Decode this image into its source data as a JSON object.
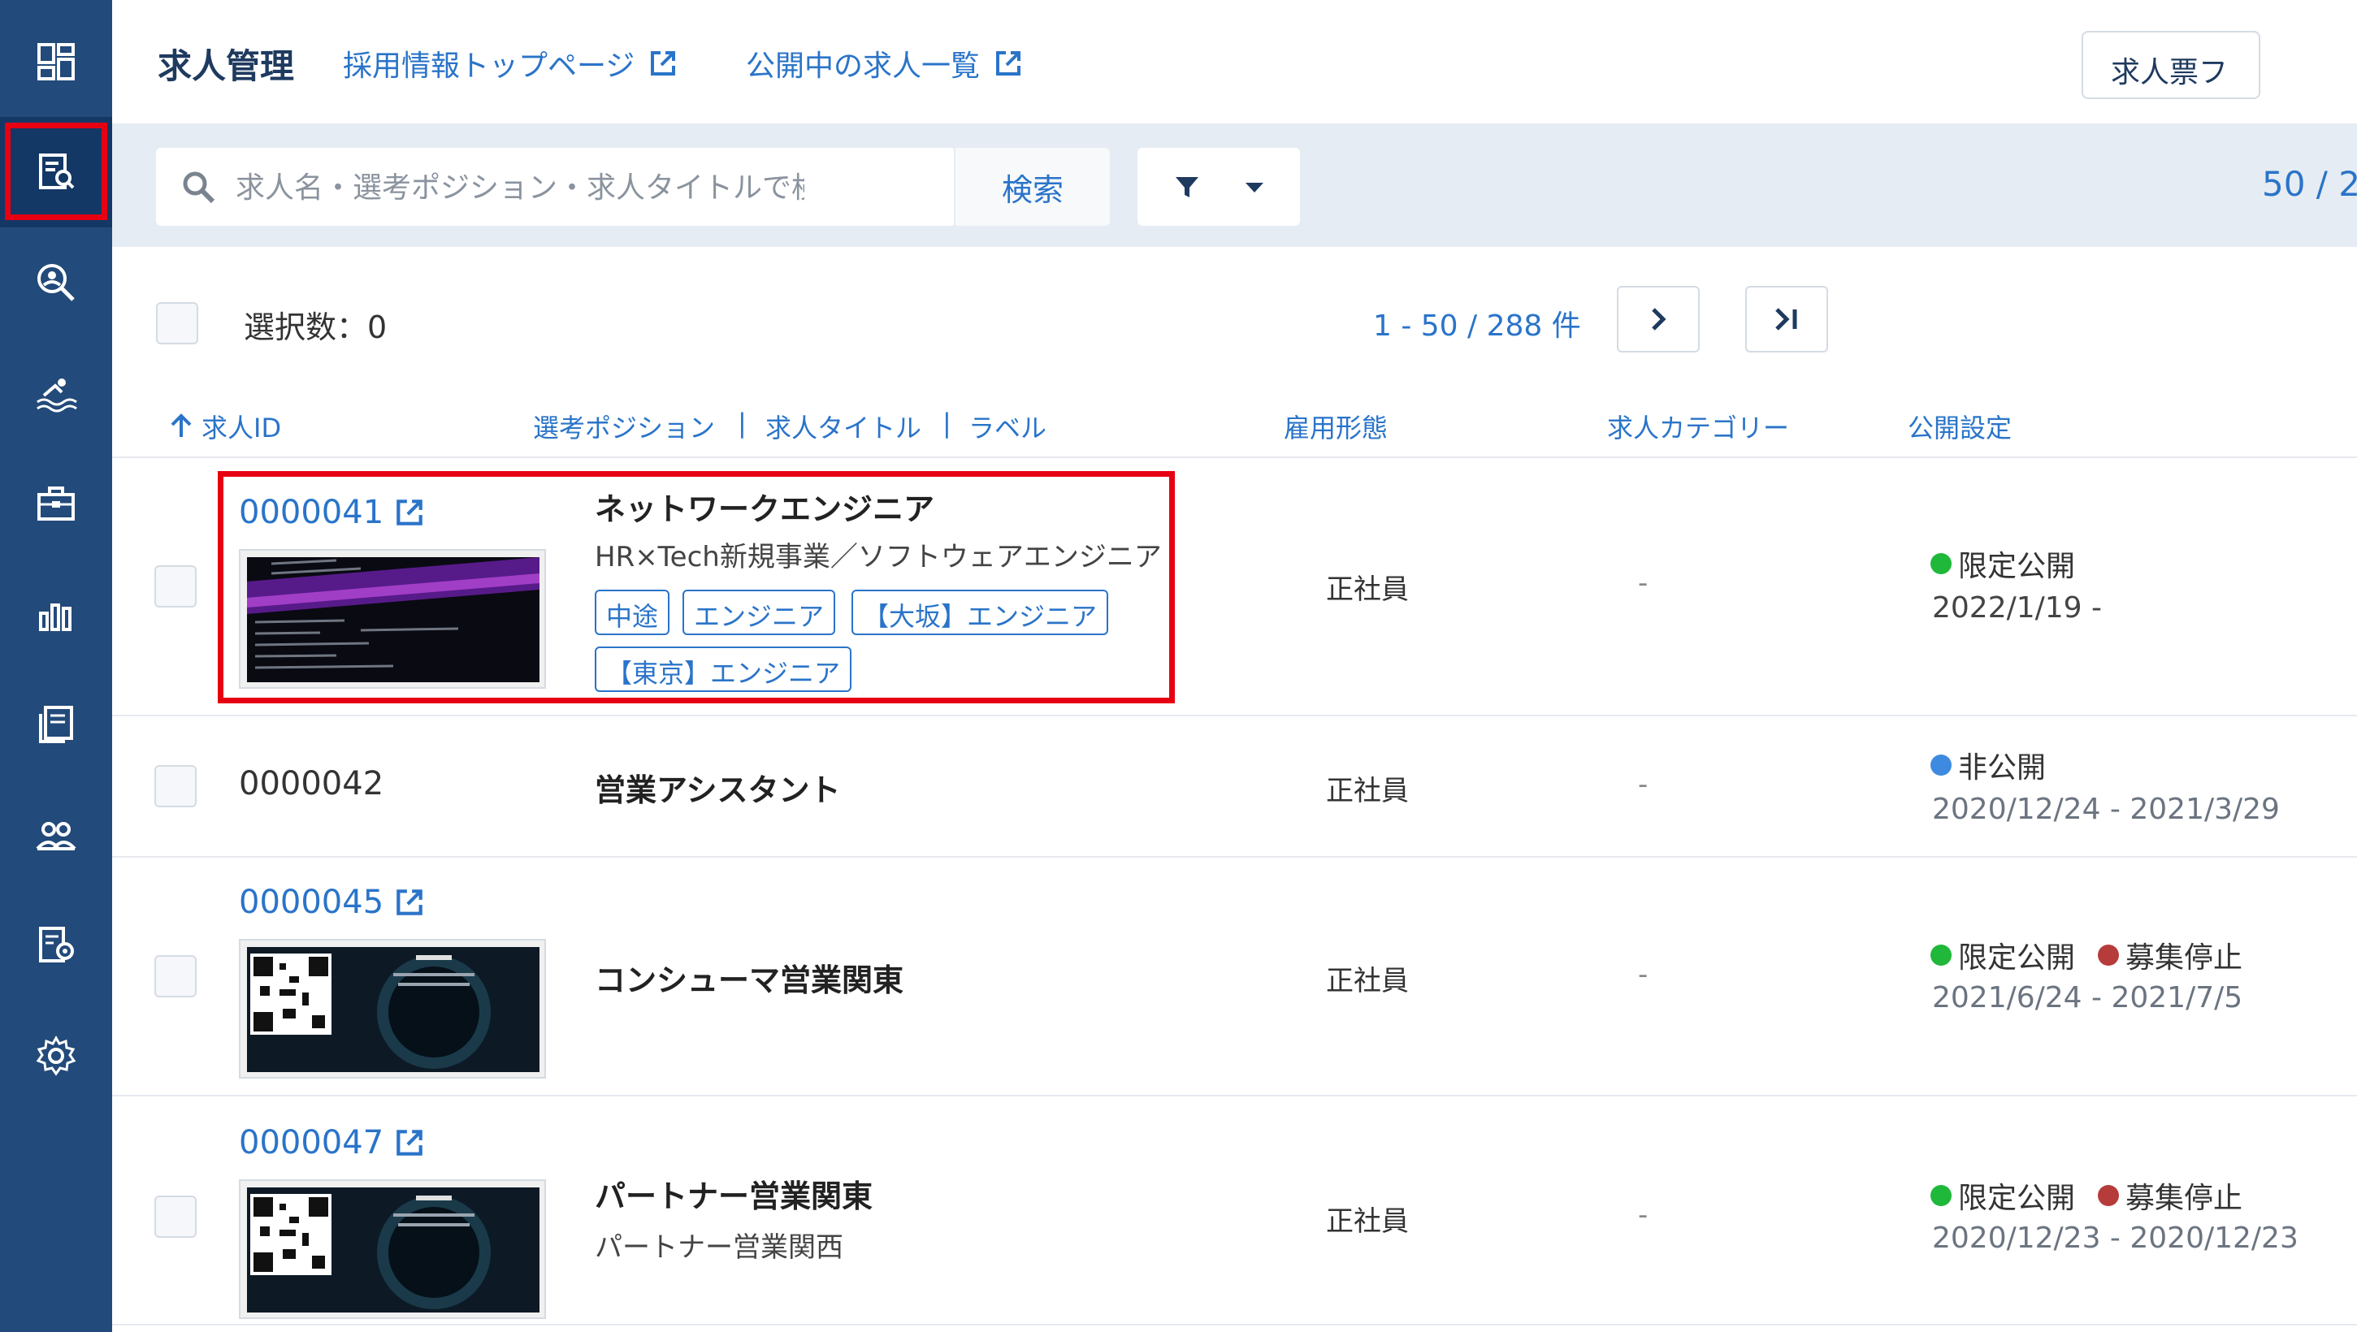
{
  "header": {
    "title": "求人管理",
    "link_recruit_top": "採用情報トップページ",
    "link_open_jobs": "公開中の求人一覧",
    "right_button": "求人票フ"
  },
  "search": {
    "placeholder": "求人名・選考ポジション・求人タイトルで検索",
    "button": "検索",
    "count": "50 / 2"
  },
  "selection": {
    "label": "選択数：0"
  },
  "pagination": {
    "range": "1 - 50 / 288 件"
  },
  "columns": {
    "id": "求人ID",
    "position": "選考ポジション",
    "title": "求人タイトル",
    "label": "ラベル",
    "employment": "雇用形態",
    "category": "求人カテゴリー",
    "publish": "公開設定"
  },
  "rows": [
    {
      "id": "0000041",
      "position": "ネットワークエンジニア",
      "subtitle": "HR×Tech新規事業／ソフトウェアエンジニア",
      "tags": [
        "中途",
        "エンジニア",
        "【大坂】エンジニア",
        "【東京】エンジニア"
      ],
      "employment": "正社員",
      "category": "-",
      "status1": "限定公開",
      "period": "2022/1/19 -"
    },
    {
      "id": "0000042",
      "position": "営業アシスタント",
      "employment": "正社員",
      "category": "-",
      "status1": "非公開",
      "period": "2020/12/24 - 2021/3/29"
    },
    {
      "id": "0000045",
      "position": "コンシューマ営業関東",
      "employment": "正社員",
      "category": "-",
      "status1": "限定公開",
      "status2": "募集停止",
      "period": "2021/6/24 - 2021/7/5"
    },
    {
      "id": "0000047",
      "position": "パートナー営業関東",
      "subtitle": "パートナー営業関西",
      "employment": "正社員",
      "category": "-",
      "status1": "限定公開",
      "status2": "募集停止",
      "period": "2020/12/23 - 2020/12/23"
    }
  ],
  "colors": {
    "sidebar": "#224a7a",
    "accent": "#2a74c9",
    "highlight": "#e60012",
    "status_limited": "#1fb83a",
    "status_private": "#3e8ae0",
    "status_stopped": "#b63b3b"
  }
}
